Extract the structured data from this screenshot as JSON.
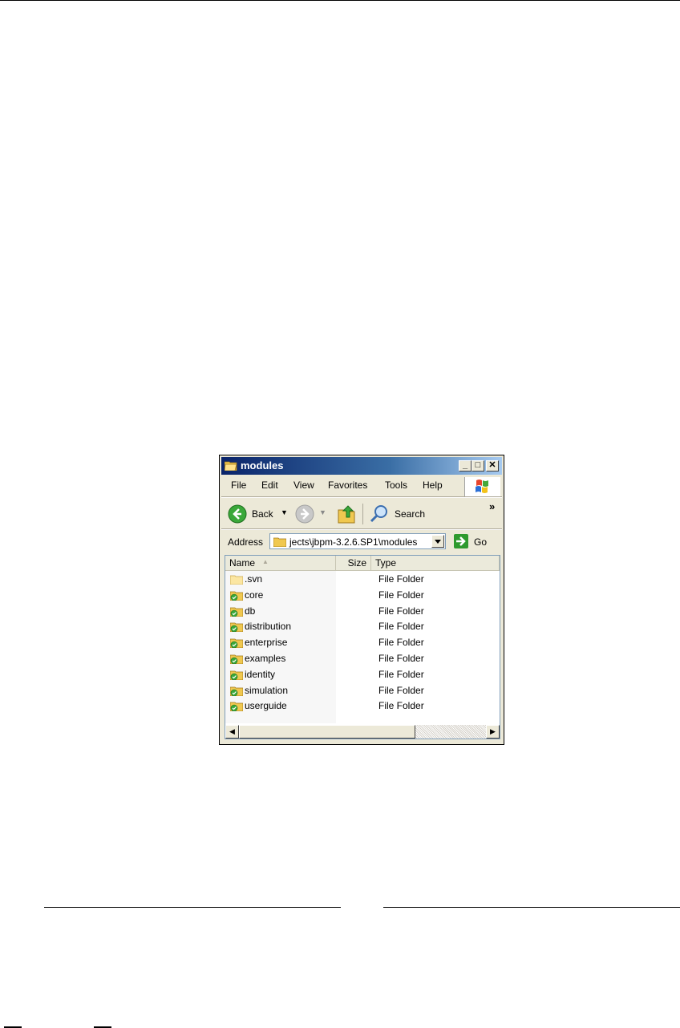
{
  "window": {
    "title": "modules",
    "controls": {
      "minimize": "_",
      "maximize": "□",
      "close": "✕"
    }
  },
  "menu": [
    "File",
    "Edit",
    "View",
    "Favorites",
    "Tools",
    "Help"
  ],
  "toolbar": {
    "back_label": "Back",
    "search_label": "Search",
    "overflow": "»"
  },
  "address": {
    "label": "Address",
    "value": "jects\\jbpm-3.2.6.SP1\\modules",
    "go_label": "Go"
  },
  "list": {
    "columns": {
      "name": "Name",
      "size": "Size",
      "type": "Type"
    },
    "rows": [
      {
        "name": ".svn",
        "type": "File Folder",
        "icon": "plain-folder-icon"
      },
      {
        "name": "core",
        "type": "File Folder",
        "icon": "svn-folder-icon"
      },
      {
        "name": "db",
        "type": "File Folder",
        "icon": "svn-folder-icon"
      },
      {
        "name": "distribution",
        "type": "File Folder",
        "icon": "svn-folder-icon"
      },
      {
        "name": "enterprise",
        "type": "File Folder",
        "icon": "svn-folder-icon"
      },
      {
        "name": "examples",
        "type": "File Folder",
        "icon": "svn-folder-icon"
      },
      {
        "name": "identity",
        "type": "File Folder",
        "icon": "svn-folder-icon"
      },
      {
        "name": "simulation",
        "type": "File Folder",
        "icon": "svn-folder-icon"
      },
      {
        "name": "userguide",
        "type": "File Folder",
        "icon": "svn-folder-icon"
      }
    ]
  },
  "colors": {
    "titlebar": "#0a246a",
    "window_bg": "#ece9d8",
    "folder": "#f0c850",
    "svn_badge": "#3aa83a"
  }
}
